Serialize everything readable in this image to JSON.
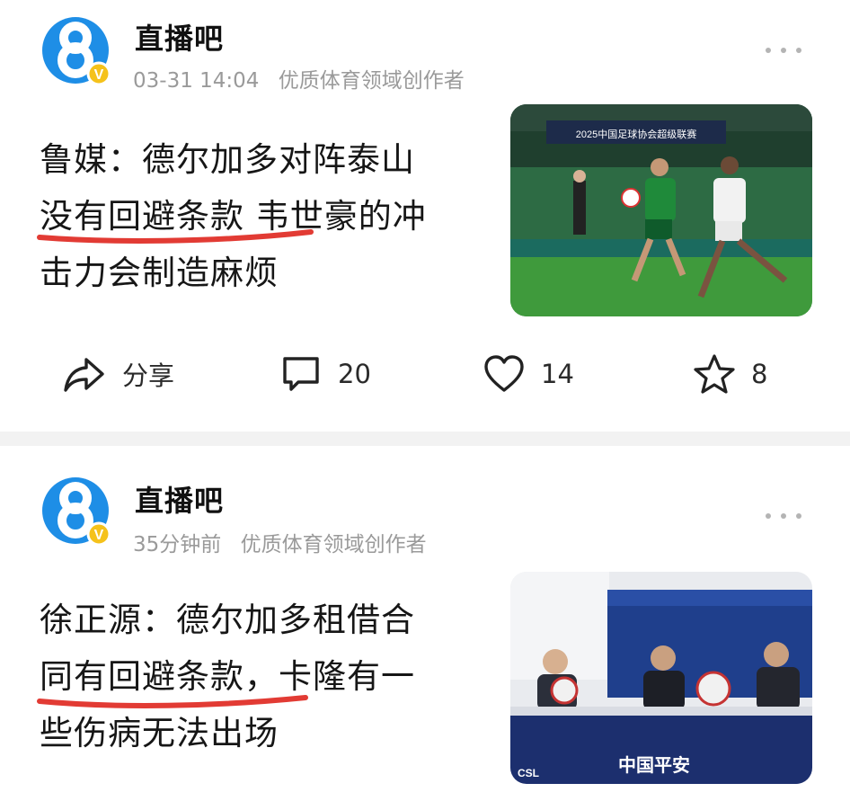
{
  "posts": [
    {
      "author": "直播吧",
      "avatar_badge": "V",
      "time": "03-31 14:04",
      "creator_tag": "优质体育领域创作者",
      "title_lines": [
        "鲁媒：德尔加多对阵泰山",
        "没有回避条款 韦世豪的冲",
        "击力会制造麻烦"
      ],
      "image_alt": "football match photo",
      "image_text": "2025中国足球协会超级联赛",
      "actions": {
        "share": "分享",
        "comments": "20",
        "likes": "14",
        "favorites": "8"
      }
    },
    {
      "author": "直播吧",
      "avatar_badge": "V",
      "time": "35分钟前",
      "creator_tag": "优质体育领域创作者",
      "title_lines": [
        "徐正源：德尔加多租借合",
        "同有回避条款，卡隆有一",
        "些伤病无法出场"
      ],
      "image_alt": "press conference photo",
      "image_text": "中国平安",
      "image_logo": "CSL"
    }
  ],
  "icons": {
    "avatar": "number-8-icon",
    "verified": "verified-badge-icon",
    "more": "more-dots-icon",
    "share": "share-icon",
    "comment": "comment-icon",
    "like": "heart-icon",
    "favorite": "star-icon"
  },
  "colors": {
    "brand_blue": "#1e8ee6",
    "badge_yellow": "#f5c21b",
    "underline_red": "#e23b34",
    "meta_gray": "#9a9a9a"
  }
}
